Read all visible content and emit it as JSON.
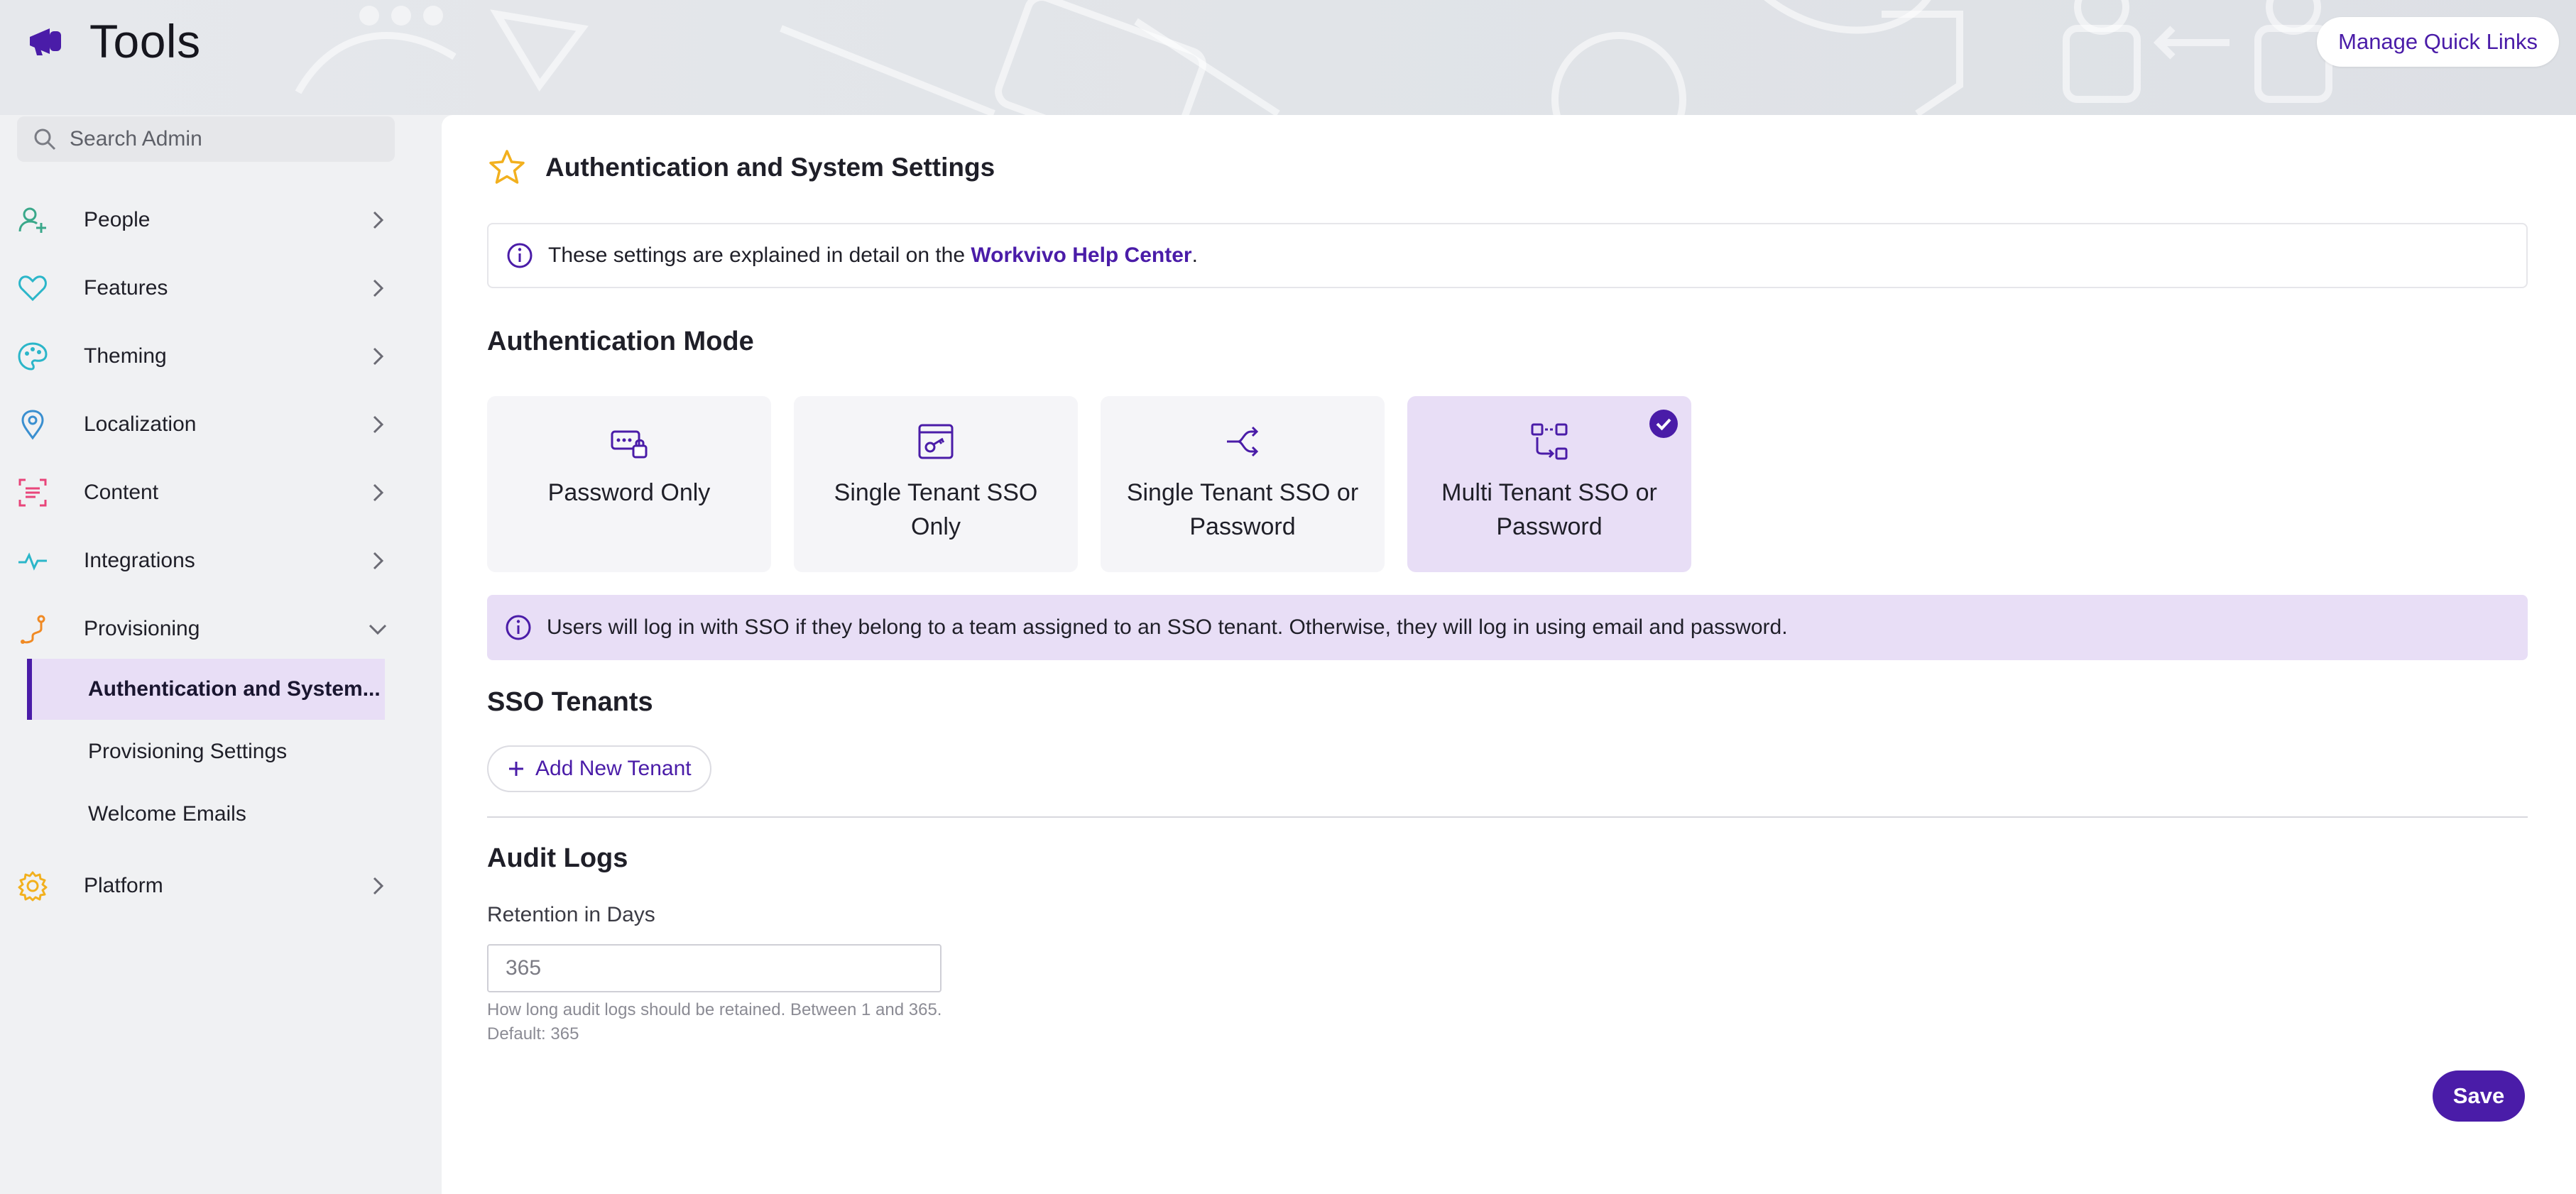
{
  "header": {
    "app_title": "Tools",
    "quick_links_label": "Manage Quick Links"
  },
  "sidebar": {
    "search_placeholder": "Search Admin",
    "items": [
      {
        "label": "People",
        "icon": "person-add-icon",
        "color": "#3aa88a"
      },
      {
        "label": "Features",
        "icon": "heart-icon",
        "color": "#2bb6c9"
      },
      {
        "label": "Theming",
        "icon": "palette-icon",
        "color": "#2bb6c9"
      },
      {
        "label": "Localization",
        "icon": "location-pin-icon",
        "color": "#3a8fd0"
      },
      {
        "label": "Content",
        "icon": "content-scan-icon",
        "color": "#e8457a"
      },
      {
        "label": "Integrations",
        "icon": "pulse-icon",
        "color": "#2bb6c9"
      },
      {
        "label": "Provisioning",
        "icon": "route-icon",
        "color": "#f08a24",
        "expanded": true
      },
      {
        "label": "Platform",
        "icon": "gear-icon",
        "color": "#f2b01e"
      }
    ],
    "provisioning_subitems": [
      {
        "label": "Authentication and System...",
        "active": true
      },
      {
        "label": "Provisioning Settings",
        "active": false
      },
      {
        "label": "Welcome Emails",
        "active": false
      }
    ]
  },
  "main": {
    "page_title": "Authentication and System Settings",
    "info_text": "These settings are explained in detail on the ",
    "info_link": "Workvivo Help Center",
    "info_end": ".",
    "auth_mode_title": "Authentication Mode",
    "auth_modes": [
      {
        "label": "Password Only",
        "icon": "password-lock-icon",
        "selected": false
      },
      {
        "label": "Single Tenant SSO Only",
        "icon": "sso-window-icon",
        "selected": false
      },
      {
        "label": "Single Tenant SSO or Password",
        "icon": "split-arrow-icon",
        "selected": false
      },
      {
        "label": "Multi Tenant SSO or Password",
        "icon": "multi-tenant-icon",
        "selected": true
      }
    ],
    "mode_notice": "Users will log in with SSO if they belong to a team assigned to an SSO tenant. Otherwise, they will log in using email and password.",
    "sso_title": "SSO Tenants",
    "add_tenant_label": "Add New Tenant",
    "audit_title": "Audit Logs",
    "retention_label": "Retention in Days",
    "retention_placeholder": "365",
    "retention_help_1": "How long audit logs should be retained. Between 1 and 365.",
    "retention_help_2": "Default: 365",
    "save_label": "Save"
  },
  "colors": {
    "accent": "#4a1ca8",
    "selected_bg": "#e8def6",
    "star": "#f2b01e"
  }
}
